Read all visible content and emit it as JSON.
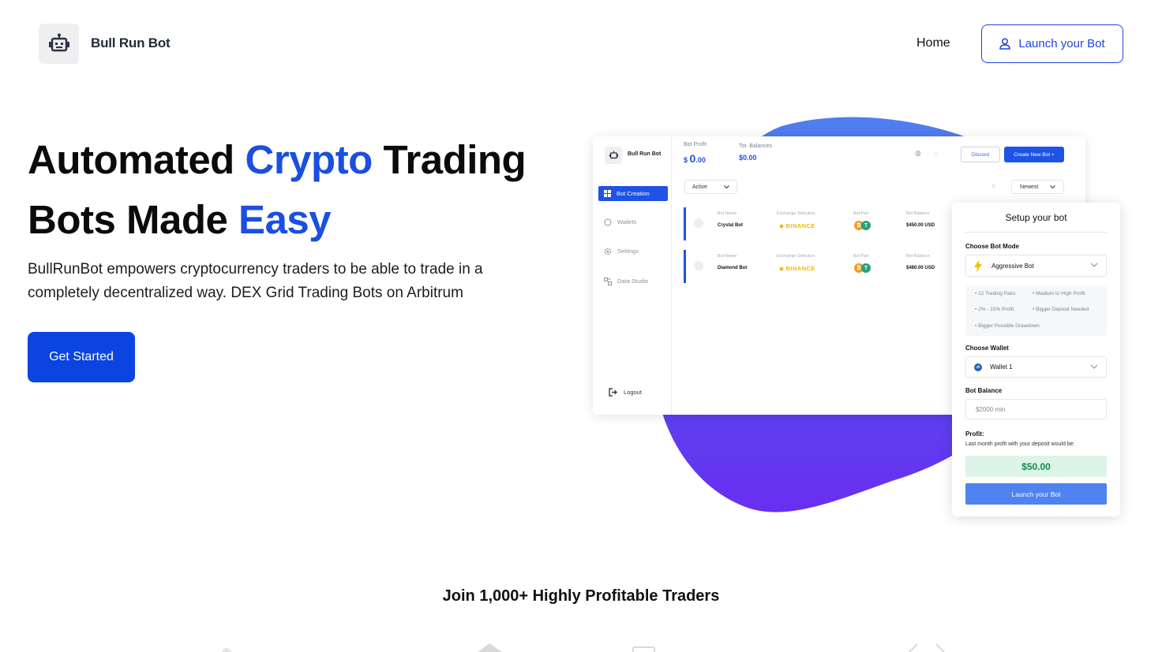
{
  "header": {
    "brand": "Bull Run Bot",
    "nav_home": "Home",
    "launch_label": "Launch your Bot"
  },
  "hero": {
    "title_part1": "Automated ",
    "title_highlight1": "Crypto",
    "title_part2": " Trading",
    "title_part3": "Bots Made ",
    "title_highlight2": "Easy",
    "description": "BullRunBot empowers cryptocurrency traders to be able to trade in a completely decentralized way. DEX Grid Trading Bots on Arbitrum",
    "cta_label": "Get Started",
    "accent_color": "#1a4fe0"
  },
  "dashboard": {
    "brand": "Bull Run Bot",
    "sidebar": [
      {
        "label": "Bot Creation",
        "icon": "grid-icon"
      },
      {
        "label": "Wallets",
        "icon": "wallet-icon"
      },
      {
        "label": "Settings",
        "icon": "gear-icon"
      },
      {
        "label": "Data Studio",
        "icon": "data-icon"
      }
    ],
    "logout_label": "Logout",
    "bot_profit_label": "Bot Profit",
    "bot_profit_currency": "$",
    "bot_profit_value": "0",
    "bot_profit_cents": ".00",
    "tot_balances_label": "Tot. Balances",
    "tot_balances_value": "$0.00",
    "discord_label": "Discord",
    "create_label": "Create New Bot +",
    "filter_value": "Active",
    "sort_value": "Newest",
    "columns": [
      "Bot Name",
      "Exchange Selection",
      "Bot Pair",
      "Bot Balance"
    ],
    "bots": [
      {
        "name": "Crystal Bot",
        "exchange": "BINANCE",
        "balance": "$450.00 USD"
      },
      {
        "name": "Diamond Bot",
        "exchange": "BINANCE",
        "balance": "$480.00 USD"
      }
    ]
  },
  "setup": {
    "title": "Setup your bot",
    "mode_label": "Choose Bot Mode",
    "mode_value": "Aggressive Bot",
    "features": [
      "12 Trading Pairs",
      "Medium to High Profit",
      "2% - 15% Profit",
      "Bigger Deposit Needed",
      "Bigger Possible Drawdown"
    ],
    "wallet_label": "Choose Wallet",
    "wallet_value": "Wallet 1",
    "balance_label": "Bot Balance",
    "balance_placeholder": "$2000 min",
    "profit_label": "Profit:",
    "profit_sub": "Last month profit with your deposit would be:",
    "profit_value": "$50.00",
    "launch_label": "Launch your Bot"
  },
  "join": {
    "text": "Join 1,000+ Highly Profitable Traders"
  }
}
